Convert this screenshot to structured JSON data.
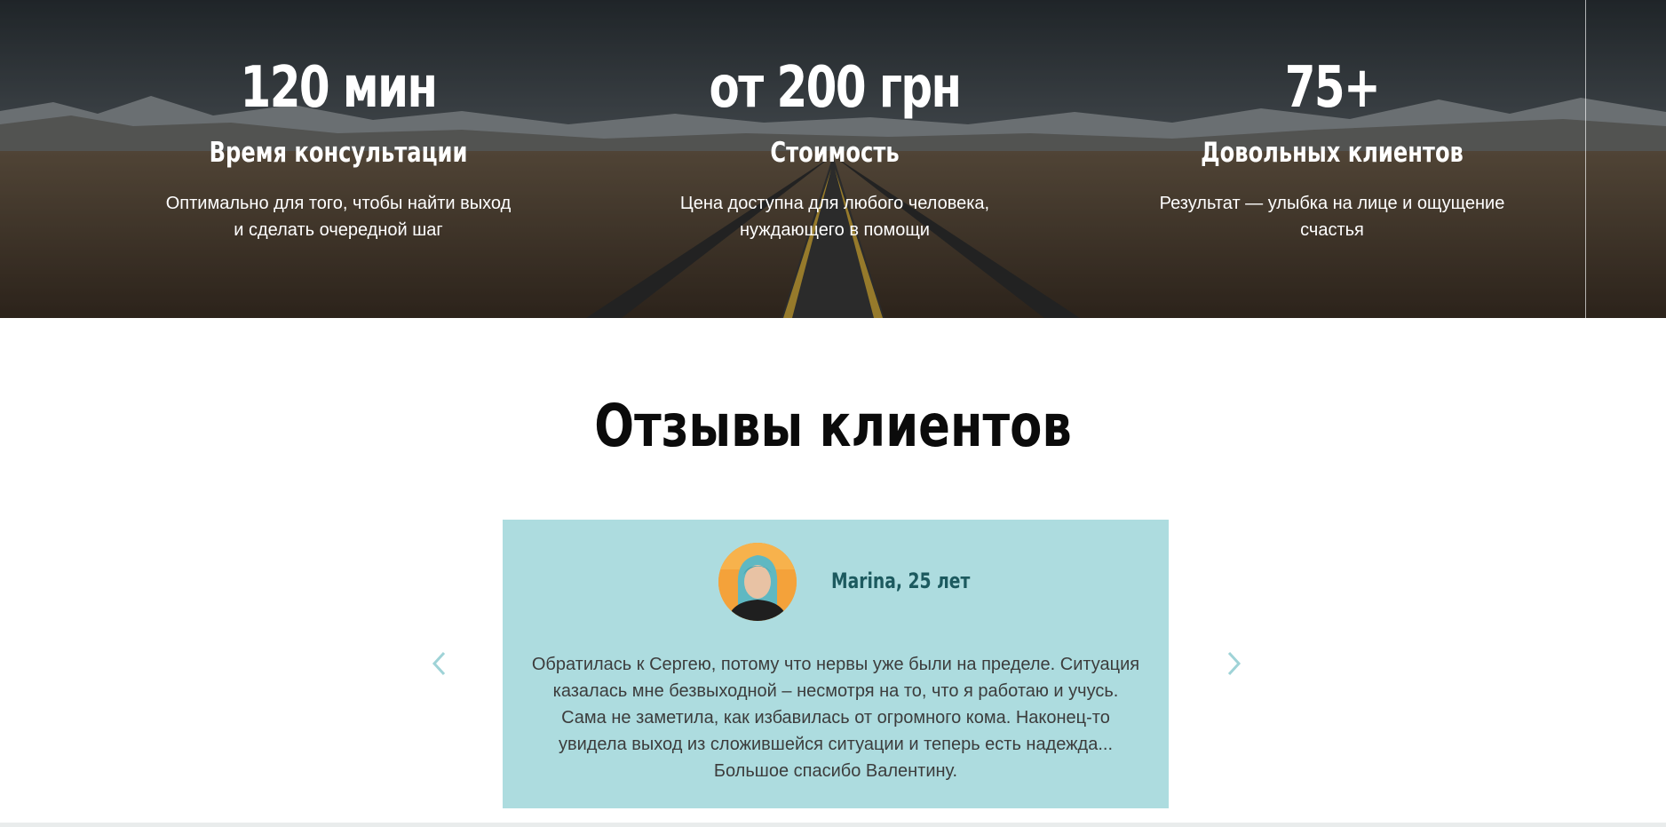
{
  "stats": [
    {
      "value": "120 мин",
      "label": "Время консультации",
      "description": "Оптимально для того, чтобы найти выход и сделать очередной шаг"
    },
    {
      "value": "от 200 грн",
      "label": "Стоимость",
      "description": "Цена доступна для любого человека, нуждающего в помощи"
    },
    {
      "value": "75+",
      "label": "Довольных клиентов",
      "description": "Результат — улыбка на лице и ощущение счастья"
    }
  ],
  "reviews": {
    "title": "Отзывы клиентов",
    "current": {
      "author": "Marina, 25 лет",
      "text": "Обратилась к Сергею, потому что нервы уже были на пределе. Ситуация казалась мне безвыходной – несмотря на то, что я работаю и учусь. Сама не заметила, как избавилась от огромного кома. Наконец-то увидела выход из сложившейся ситуации и теперь есть надежда... Большое спасибо Валентину."
    },
    "prev_icon": "chevron-left-icon",
    "next_icon": "chevron-right-icon"
  },
  "colors": {
    "card_background": "#addcdf",
    "author": "#1c5a5f",
    "arrow": "#9fd3d7",
    "title": "#0b0b0b"
  }
}
